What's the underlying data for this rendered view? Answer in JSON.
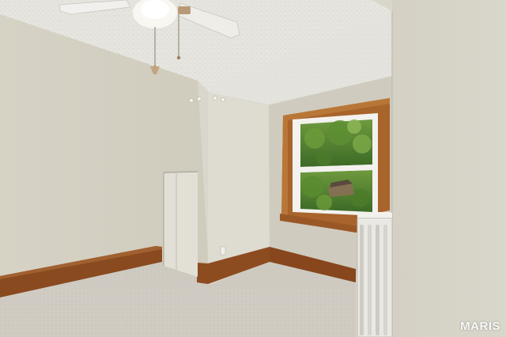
{
  "scene": {
    "description_tags": [
      "ceiling-fan",
      "sloped-ceiling",
      "window",
      "closet-door",
      "radiator",
      "carpet",
      "baseboard"
    ]
  },
  "watermark": {
    "text": "MARIS"
  },
  "colors": {
    "wall": "#d8d4c8",
    "wall_shadow": "#c7c3b6",
    "ceiling": "#e8e7e2",
    "carpet": "#cfcbc2",
    "wood_trim": "#8a4a20",
    "window_frame": "#b8702e",
    "radiator": "#ecebe7",
    "foliage": "#4d7a2e"
  }
}
